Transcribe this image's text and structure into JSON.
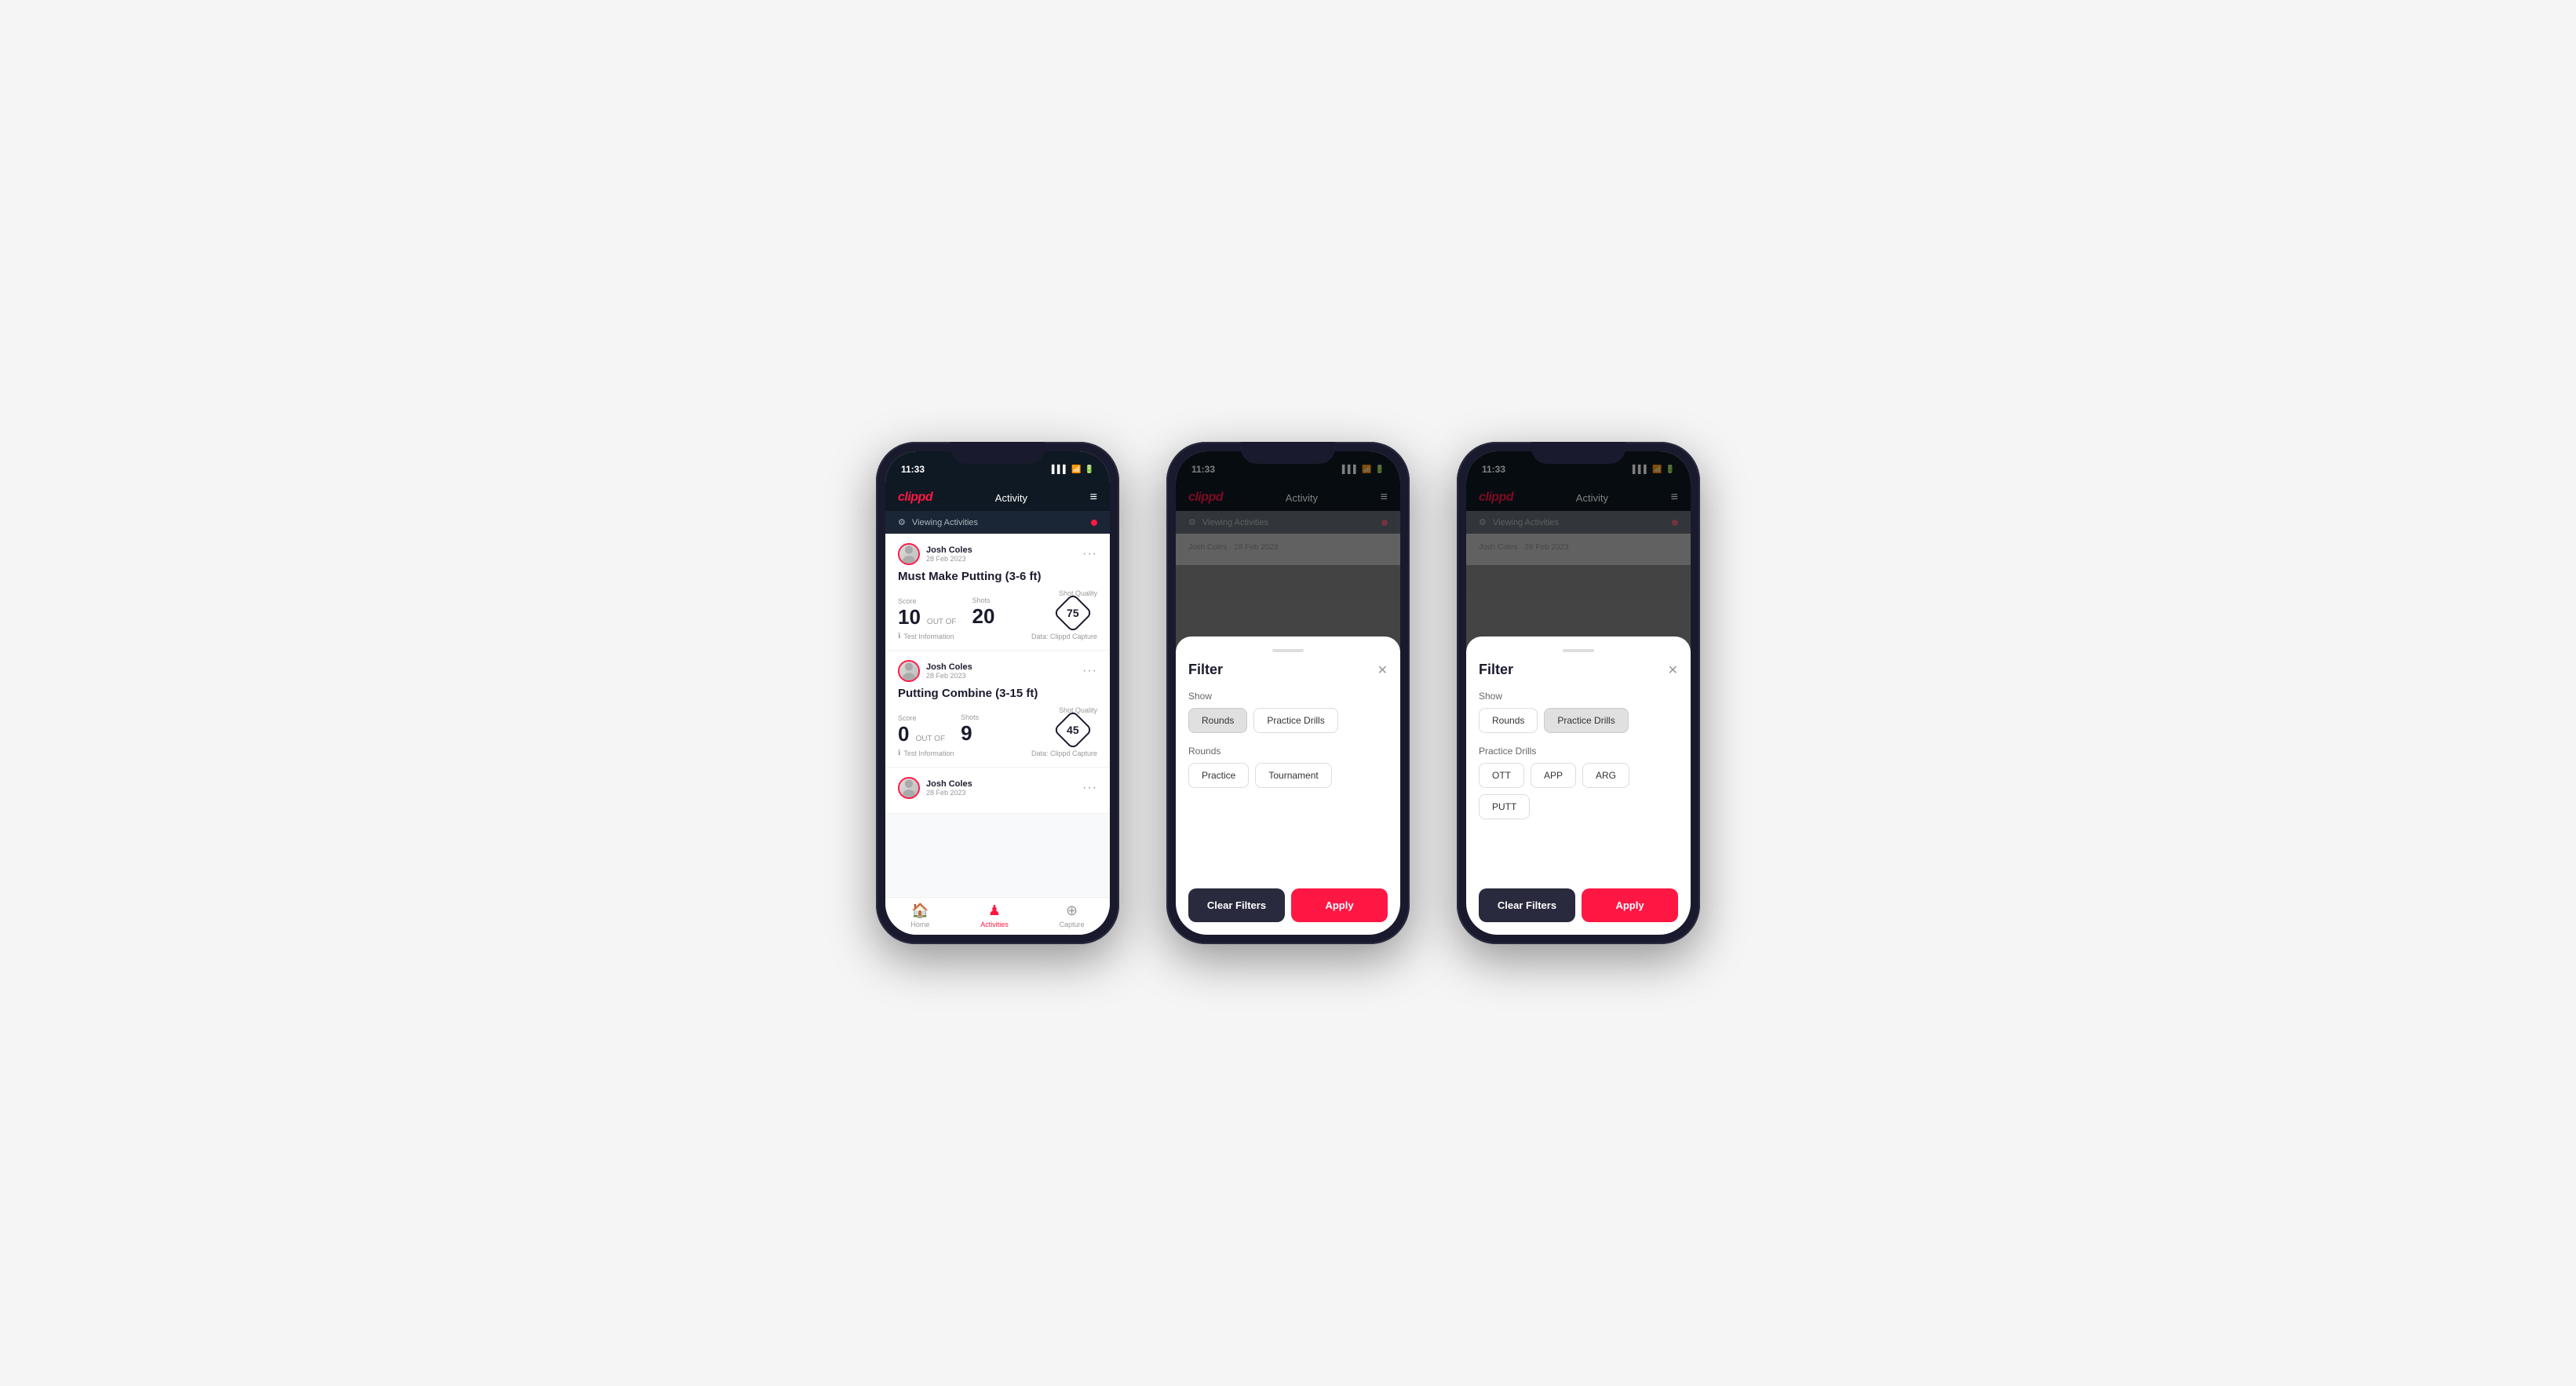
{
  "app": {
    "time": "11:33",
    "signal_bars": "▌▌▌",
    "wifi_icon": "wifi",
    "battery": "51",
    "logo": "clippd",
    "title": "Activity",
    "menu_icon": "≡"
  },
  "viewing_banner": {
    "icon": "⚙",
    "label": "Viewing Activities"
  },
  "phone1": {
    "cards": [
      {
        "user": "Josh Coles",
        "date": "28 Feb 2023",
        "title": "Must Make Putting (3-6 ft)",
        "score_label": "Score",
        "score_value": "10",
        "out_of_label": "OUT OF",
        "shots_label": "Shots",
        "shots_value": "20",
        "shot_quality_label": "Shot Quality",
        "shot_quality_value": "75",
        "test_info": "Test Information",
        "data_source": "Data: Clippd Capture"
      },
      {
        "user": "Josh Coles",
        "date": "28 Feb 2023",
        "title": "Putting Combine (3-15 ft)",
        "score_label": "Score",
        "score_value": "0",
        "out_of_label": "OUT OF",
        "shots_label": "Shots",
        "shots_value": "9",
        "shot_quality_label": "Shot Quality",
        "shot_quality_value": "45",
        "test_info": "Test Information",
        "data_source": "Data: Clippd Capture"
      },
      {
        "user": "Josh Coles",
        "date": "28 Feb 2023"
      }
    ],
    "nav": {
      "items": [
        {
          "label": "Home",
          "icon": "🏠",
          "active": false
        },
        {
          "label": "Activities",
          "icon": "👤",
          "active": true
        },
        {
          "label": "Capture",
          "icon": "⊕",
          "active": false
        }
      ]
    }
  },
  "phone2": {
    "filter": {
      "title": "Filter",
      "show_label": "Show",
      "buttons_show": [
        {
          "label": "Rounds",
          "active": true
        },
        {
          "label": "Practice Drills",
          "active": false
        }
      ],
      "rounds_label": "Rounds",
      "buttons_rounds": [
        {
          "label": "Practice",
          "active": false
        },
        {
          "label": "Tournament",
          "active": false
        }
      ],
      "clear_filters": "Clear Filters",
      "apply": "Apply"
    }
  },
  "phone3": {
    "filter": {
      "title": "Filter",
      "show_label": "Show",
      "buttons_show": [
        {
          "label": "Rounds",
          "active": false
        },
        {
          "label": "Practice Drills",
          "active": true
        }
      ],
      "practice_drills_label": "Practice Drills",
      "buttons_drills": [
        {
          "label": "OTT",
          "active": false
        },
        {
          "label": "APP",
          "active": false
        },
        {
          "label": "ARG",
          "active": false
        },
        {
          "label": "PUTT",
          "active": false
        }
      ],
      "clear_filters": "Clear Filters",
      "apply": "Apply"
    }
  }
}
